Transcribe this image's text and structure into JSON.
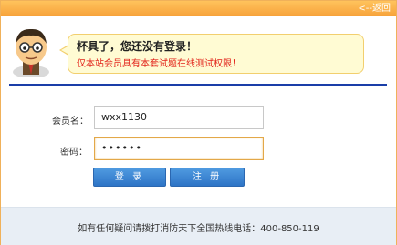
{
  "header": {
    "back_label": "<--返回"
  },
  "notice": {
    "title": "杯具了，您还没有登录！",
    "message": "仅本站会员具有本套试题在线测试权限！"
  },
  "form": {
    "username_label": "会员名：",
    "username_value": "wxx1130",
    "password_label": "密码：",
    "password_masked": "••••••"
  },
  "buttons": {
    "login_label": "登 录",
    "register_label": "注 册"
  },
  "footer": {
    "text": "如有任何疑问请拨打消防天下全国热线电话：400-850-119"
  }
}
